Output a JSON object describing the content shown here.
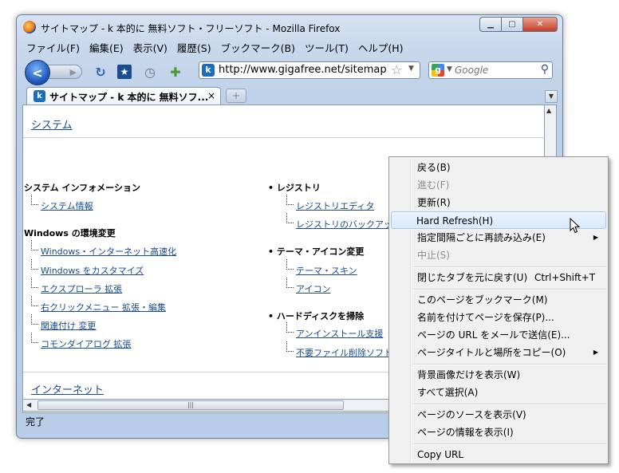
{
  "window": {
    "title": "サイトマップ - k 本的に 無料ソフト・フリーソフト - Mozilla Firefox",
    "controls": {
      "min": "▁",
      "max": "▢",
      "close": "✕"
    }
  },
  "menubar": [
    "ファイル(F)",
    "編集(E)",
    "表示(V)",
    "履歴(S)",
    "ブックマーク(B)",
    "ツール(T)",
    "ヘルプ(H)"
  ],
  "navbar": {
    "url": "http://www.gigafree.net/sitemap.h",
    "search_placeholder": "Google",
    "icons": [
      "back-icon",
      "forward-icon",
      "reload-icon",
      "bookmark-icon",
      "history-icon",
      "addons-icon",
      "star-icon",
      "search-icon"
    ]
  },
  "tabs": [
    {
      "label": "サイトマップ - k 本的に 無料ソフ...",
      "close": "×"
    }
  ],
  "newtab": "+",
  "content": {
    "sections": [
      {
        "heading": "システム",
        "columns": [
          {
            "groups": [
              {
                "title": "システム インフォメーション",
                "links": [
                  "システム情報"
                ]
              },
              {
                "title": "Windows の環境変更",
                "links": [
                  "Windows・インターネット高速化",
                  "Windows をカスタマイズ",
                  "エクスプローラ 拡張",
                  "右クリックメニュー 拡張・編集",
                  "関連付け 変更",
                  "コモンダイアログ 拡張"
                ]
              }
            ]
          },
          {
            "groups": [
              {
                "title": "レジストリ",
                "links": [
                  "レジストリエディタ",
                  "レジストリのバックアップ"
                ]
              },
              {
                "title": "テーマ・アイコン変更",
                "links": [
                  "テーマ・スキン",
                  "アイコン"
                ]
              },
              {
                "title": "ハードディスクを掃除",
                "links": [
                  "アンインストール支援",
                  "不要ファイル削除ソフト"
                ]
              }
            ]
          }
        ]
      },
      {
        "heading": "インターネット"
      }
    ]
  },
  "status": "完了",
  "context_menu": [
    {
      "label": "戻る(B)",
      "enabled": true
    },
    {
      "label": "進む(F)",
      "enabled": false
    },
    {
      "label": "更新(R)",
      "enabled": true
    },
    {
      "label": "Hard Refresh(H)",
      "enabled": true,
      "highlighted": true
    },
    {
      "label": "指定間隔ごとに再読み込み(E)",
      "enabled": true,
      "submenu": true
    },
    {
      "label": "中止(S)",
      "enabled": false
    },
    {
      "separator": true
    },
    {
      "label": "閉じたタブを元に戻す(U)",
      "shortcut": "Ctrl+Shift+T",
      "enabled": true
    },
    {
      "separator": true
    },
    {
      "label": "このページをブックマーク(M)",
      "enabled": true
    },
    {
      "label": "名前を付けてページを保存(P)...",
      "enabled": true
    },
    {
      "label": "ページの URL をメールで送信(E)...",
      "enabled": true
    },
    {
      "label": "ページタイトルと場所をコピー(O)",
      "enabled": true,
      "submenu": true
    },
    {
      "separator": true
    },
    {
      "label": "背景画像だけを表示(W)",
      "enabled": true
    },
    {
      "label": "すべて選択(A)",
      "enabled": true
    },
    {
      "separator": true
    },
    {
      "label": "ページのソースを表示(V)",
      "enabled": true
    },
    {
      "label": "ページの情報を表示(I)",
      "enabled": true
    },
    {
      "separator": true
    },
    {
      "label": "Copy URL",
      "enabled": true
    }
  ]
}
